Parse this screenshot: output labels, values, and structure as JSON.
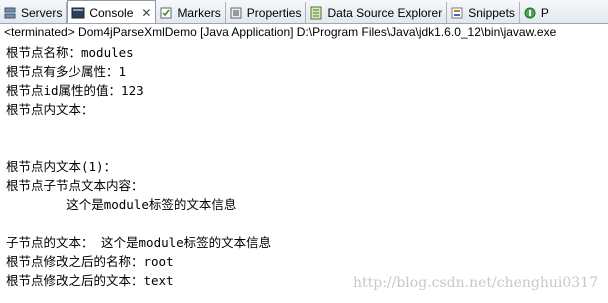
{
  "tabs": [
    {
      "label": "Servers",
      "icon": "servers-icon",
      "active": false
    },
    {
      "label": "Console",
      "icon": "console-icon",
      "active": true
    },
    {
      "label": "Markers",
      "icon": "markers-icon",
      "active": false
    },
    {
      "label": "Properties",
      "icon": "properties-icon",
      "active": false
    },
    {
      "label": "Data Source Explorer",
      "icon": "data-source-icon",
      "active": false
    },
    {
      "label": "Snippets",
      "icon": "snippets-icon",
      "active": false
    },
    {
      "label": "P",
      "icon": "progress-icon",
      "active": false
    }
  ],
  "console_close_glyph": "✕",
  "status_text": "<terminated> Dom4jParseXmlDemo [Java Application] D:\\Program Files\\Java\\jdk1.6.0_12\\bin\\javaw.exe",
  "console_lines": [
    "根节点名称：modules",
    "根节点有多少属性：1",
    "根节点id属性的值：123",
    "根节点内文本：",
    "",
    "",
    "根节点内文本(1)：",
    "根节点子节点文本内容：",
    "        这个是module标签的文本信息",
    "",
    "子节点的文本： 这个是module标签的文本信息",
    "根节点修改之后的名称：root",
    "根节点修改之后的文本：text"
  ],
  "watermark": "http://blog.csdn.net/chenghui0317"
}
